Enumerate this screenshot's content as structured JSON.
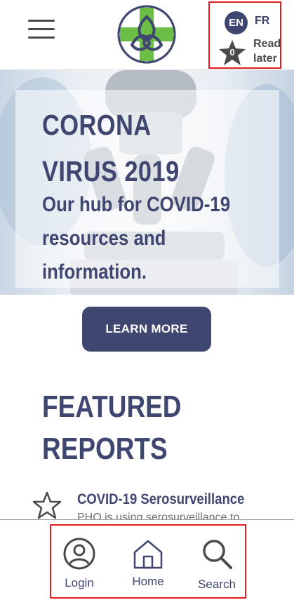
{
  "header": {
    "menu_icon": "hamburger-menu-icon",
    "logo_icon": "green-cross-logo-icon",
    "languages": {
      "active": "EN",
      "alternate": "FR"
    },
    "read_later": {
      "count": "0",
      "label_line1": "Read",
      "label_line2": "later",
      "icon": "star-icon"
    }
  },
  "hero": {
    "title": "CORONA VIRUS 2019",
    "subtitle": "Our hub for COVID-19 resources and information.",
    "button_label": "LEARN MORE"
  },
  "featured": {
    "heading": "FEATURED REPORTS",
    "reports": [
      {
        "title": "COVID-19 Serosurveillance",
        "description": "PHO is using serosurveillance to",
        "icon": "star-outline-icon"
      }
    ]
  },
  "bottom_nav": {
    "items": [
      {
        "label": "Login",
        "icon": "user-circle-icon"
      },
      {
        "label": "Home",
        "icon": "home-icon"
      },
      {
        "label": "Search",
        "icon": "search-icon"
      }
    ]
  },
  "colors": {
    "primary": "#3f4670",
    "accent_green": "#6cbd45",
    "highlight": "#e02020"
  }
}
